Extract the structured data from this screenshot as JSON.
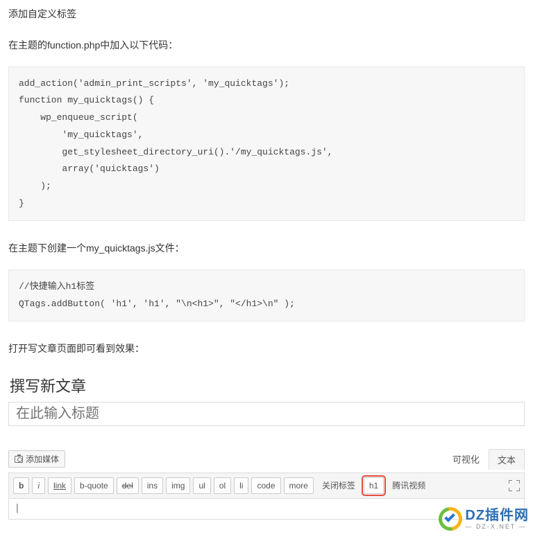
{
  "article": {
    "heading": "添加自定义标签",
    "para1": "在主题的function.php中加入以下代码：",
    "code1": "add_action('admin_print_scripts', 'my_quicktags');\nfunction my_quicktags() {\n    wp_enqueue_script(\n        'my_quicktags',\n        get_stylesheet_directory_uri().'/my_quicktags.js',\n        array('quicktags')\n    );\n}",
    "para2": "在主题下创建一个my_quicktags.js文件：",
    "code2": "//快捷输入h1标签\nQTags.addButton( 'h1', 'h1', \"\\n<h1>\", \"</h1>\\n\" );",
    "para3": "打开写文章页面即可看到效果："
  },
  "editor": {
    "page_title": "撰写新文章",
    "title_placeholder": "在此输入标题",
    "add_media_label": "添加媒体",
    "tabs": {
      "visual": "可视化",
      "text": "文本"
    },
    "buttons": {
      "b": "b",
      "i": "i",
      "link": "link",
      "bquote": "b-quote",
      "del": "del",
      "ins": "ins",
      "img": "img",
      "ul": "ul",
      "ol": "ol",
      "li": "li",
      "code": "code",
      "more": "more",
      "close": "关闭标签",
      "h1": "h1",
      "tencent": "腾讯视频"
    },
    "content_cursor": "|"
  },
  "watermark": {
    "main": "DZ插件网",
    "sub": "— DZ-X.NET —"
  }
}
